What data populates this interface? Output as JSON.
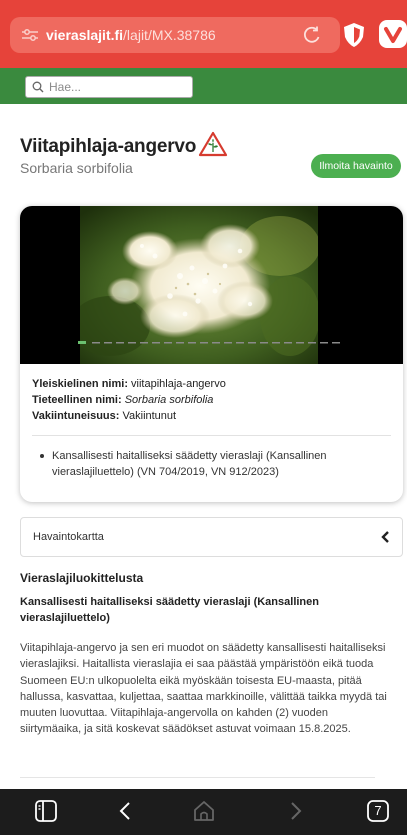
{
  "browser": {
    "url_domain": "vieraslajit.fi",
    "url_path": "/lajit/MX.38786",
    "tab_count": "7"
  },
  "search": {
    "placeholder": "Hae..."
  },
  "species": {
    "title": "Viitapihlaja-angervo",
    "scientific_name": "Sorbaria sorbifolia",
    "report_button": "Ilmoita havainto"
  },
  "info": {
    "common_label": "Yleiskielinen nimi:",
    "common_value": "viitapihlaja-angervo",
    "sci_label": "Tieteellinen nimi:",
    "sci_value": "Sorbaria sorbifolia",
    "establishment_label": "Vakiintuneisuus:",
    "establishment_value": "Vakiintunut",
    "bullet": "Kansallisesti haitalliseksi säädetty vieraslaji (Kansallinen vieraslajiluettelo) (VN 704/2019, VN 912/2023)"
  },
  "accordion": {
    "label": "Havaintokartta"
  },
  "classification": {
    "heading": "Vieraslajiluokittelusta",
    "subheading": "Kansallisesti haitalliseksi säädetty vieraslaji (Kansallinen vieraslajiluettelo)",
    "body": "Viitapihlaja-angervo ja sen eri muodot on säädetty kansallisesti haitalliseksi vieraslajiksi. Haitallista vieraslajia ei saa päästää ympäristöön eikä tuoda Suomeen EU:n ulkopuolelta eikä myöskään toisesta EU-maasta, pitää hallussa, kasvattaa, kuljettaa, saattaa markkinoille, välittää taikka myydä tai muuten luovuttaa. Viitapihlaja-angervolla on kahden (2) vuoden siirtymäaika, ja sitä koskevat säädökset astuvat voimaan 15.8.2025."
  },
  "colors": {
    "browser_bar": "#e6433a",
    "site_header": "#3a8a3e",
    "accent_green": "#4caf50"
  },
  "icons": [
    "tune-icon",
    "reload-icon",
    "shield-icon",
    "vivaldi-icon",
    "search-icon",
    "warning-plant-icon",
    "chevron-left-icon",
    "panel-icon",
    "back-icon",
    "home-icon",
    "forward-icon",
    "tabs-icon"
  ]
}
